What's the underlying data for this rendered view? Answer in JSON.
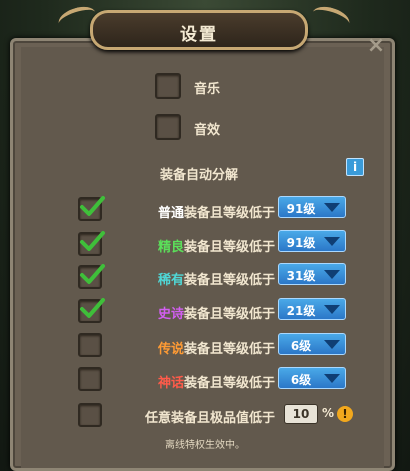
{
  "title": "设置",
  "music": {
    "label": "音乐",
    "checked": false
  },
  "sfx": {
    "label": "音效",
    "checked": false
  },
  "auto_dismantle": {
    "heading": "装备自动分解",
    "info_icon_text": "i",
    "rows": [
      {
        "prefix": "普通",
        "suffix": "装备且等级低于",
        "value": "91级",
        "checked": true
      },
      {
        "prefix": "精良",
        "suffix": "装备且等级低于",
        "value": "91级",
        "checked": true
      },
      {
        "prefix": "稀有",
        "suffix": "装备且等级低于",
        "value": "31级",
        "checked": true
      },
      {
        "prefix": "史诗",
        "suffix": "装备且等级低于",
        "value": "21级",
        "checked": true
      },
      {
        "prefix": "传说",
        "suffix": "装备且等级低于",
        "value": "6级",
        "checked": false
      },
      {
        "prefix": "神话",
        "suffix": "装备且等级低于",
        "value": "6级",
        "checked": false
      }
    ],
    "quality_row": {
      "label": "任意装备且极品值低于",
      "value": "10",
      "unit": "%",
      "checked": false,
      "warn_icon_text": "!"
    }
  },
  "footer": "离线特权生效中。",
  "close_symbol": "×",
  "colors": {
    "panel": "#6b6154",
    "dropdown": "#2b77c8",
    "check": "#3fbf3a"
  }
}
